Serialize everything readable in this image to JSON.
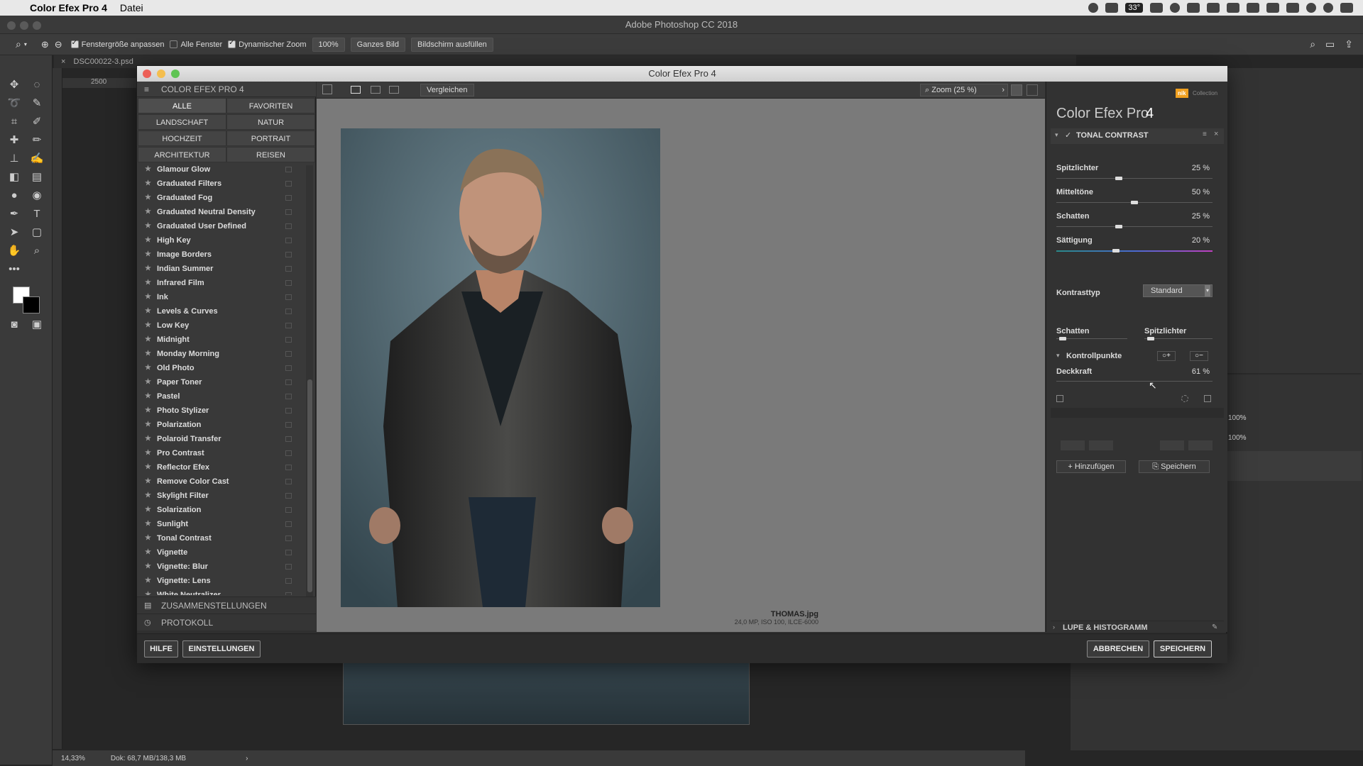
{
  "menubar": {
    "app_name": "Color Efex Pro 4",
    "menu_file": "Datei",
    "temp_badge": "33°"
  },
  "ps": {
    "window_title": "Adobe Photoshop CC 2018",
    "opt_fit": "Fenstergröße anpassen",
    "opt_all_windows": "Alle Fenster",
    "opt_dynamic_zoom": "Dynamischer Zoom",
    "opt_zoom": "100%",
    "opt_whole_image": "Ganzes Bild",
    "opt_fill_screen": "Bildschirm ausfüllen",
    "doc_tab": "DSC00022-3.psd",
    "ruler_tick": "2500",
    "status_zoom": "14,33%",
    "status_doc": "Dok: 68,7 MB/138,3 MB",
    "panel_pct_1": "100%",
    "panel_pct_2": "100%"
  },
  "dialog": {
    "title": "Color Efex Pro 4",
    "sidebar_header": "COLOR EFEX PRO 4",
    "categories": [
      "ALLE",
      "FAVORITEN",
      "LANDSCHAFT",
      "NATUR",
      "HOCHZEIT",
      "PORTRAIT",
      "ARCHITEKTUR",
      "REISEN"
    ],
    "filters": [
      "Glamour Glow",
      "Graduated Filters",
      "Graduated Fog",
      "Graduated Neutral Density",
      "Graduated User Defined",
      "High Key",
      "Image Borders",
      "Indian Summer",
      "Infrared Film",
      "Ink",
      "Levels & Curves",
      "Low Key",
      "Midnight",
      "Monday Morning",
      "Old Photo",
      "Paper Toner",
      "Pastel",
      "Photo Stylizer",
      "Polarization",
      "Polaroid Transfer",
      "Pro Contrast",
      "Reflector Efex",
      "Remove Color Cast",
      "Skylight Filter",
      "Solarization",
      "Sunlight",
      "Tonal Contrast",
      "Vignette",
      "Vignette: Blur",
      "Vignette: Lens",
      "White Neutralizer"
    ],
    "section_recipes": "ZUSAMMENSTELLUNGEN",
    "section_history": "PROTOKOLL",
    "compare_button": "Vergleichen",
    "zoom_label": "Zoom (25 %)",
    "image_name": "THOMAS.jpg",
    "image_meta": "24,0 MP, ISO 100, ILCE-6000",
    "brand_title": "Color Efex Pro",
    "brand_version": "4",
    "brand_badge": "nik",
    "brand_collection": "Collection",
    "filter_name": "TONAL CONTRAST",
    "sliders": [
      {
        "label": "Spitzlichter",
        "value": "25 %",
        "position": 0.4
      },
      {
        "label": "Mitteltöne",
        "value": "50 %",
        "position": 0.5
      },
      {
        "label": "Schatten",
        "value": "25 %",
        "position": 0.4
      },
      {
        "label": "Sättigung",
        "value": "20 %",
        "position": 0.38
      }
    ],
    "contrast_type_label": "Kontrasttyp",
    "contrast_type_value": "Standard",
    "range_shadows": "Schatten",
    "range_highlights": "Spitzlichter",
    "control_points": "Kontrollpunkte",
    "opacity_label": "Deckkraft",
    "opacity_value": "61 %",
    "add_button": "Hinzufügen",
    "save_preset_button": "Speichern",
    "loupe_section": "LUPE & HISTOGRAMM",
    "help_button": "HILFE",
    "settings_button": "EINSTELLUNGEN",
    "cancel_button": "ABBRECHEN",
    "save_button": "SPEICHERN"
  },
  "colors": {
    "accent_orange": "#f0a020",
    "panel_bg": "#323232"
  }
}
